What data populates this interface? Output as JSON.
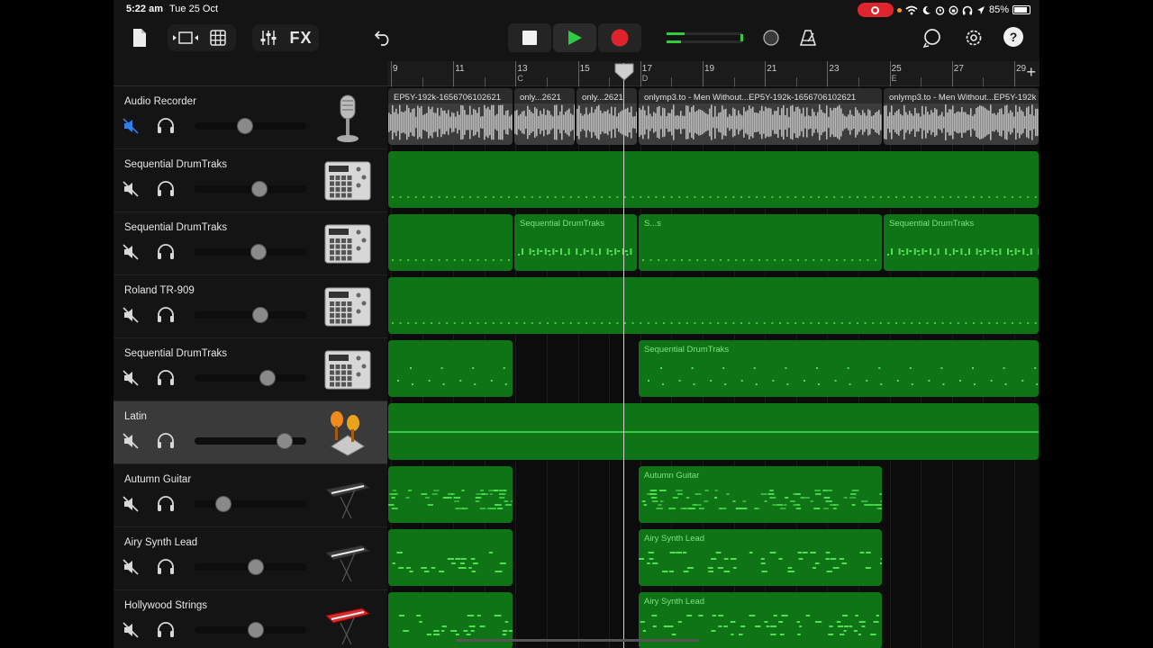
{
  "status": {
    "time": "5:22 am",
    "date": "Tue 25 Oct",
    "battery": "85%"
  },
  "toolbar": {
    "fx_label": "FX",
    "help_label": "?"
  },
  "ruler": {
    "bars": [
      "9",
      "11",
      "13",
      "15",
      "17",
      "19",
      "21",
      "23",
      "25",
      "27",
      "29"
    ],
    "markers": [
      "C",
      "D",
      "E"
    ],
    "add_label": "+"
  },
  "tracks": [
    {
      "name": "Audio Recorder",
      "muted": true,
      "volume": 0.45,
      "instrument_icon": "microphone-icon"
    },
    {
      "name": "Sequential DrumTraks",
      "muted": false,
      "volume": 0.58,
      "instrument_icon": "drum-machine-icon"
    },
    {
      "name": "Sequential DrumTraks",
      "muted": false,
      "volume": 0.57,
      "instrument_icon": "drum-machine-icon"
    },
    {
      "name": "Roland TR-909",
      "muted": false,
      "volume": 0.59,
      "instrument_icon": "drum-machine-icon"
    },
    {
      "name": "Sequential DrumTraks",
      "muted": false,
      "volume": 0.65,
      "instrument_icon": "drum-machine-icon"
    },
    {
      "name": "Latin",
      "muted": false,
      "volume": 0.81,
      "instrument_icon": "maracas-icon",
      "selected": true
    },
    {
      "name": "Autumn Guitar",
      "muted": false,
      "volume": 0.26,
      "instrument_icon": "keyboard-icon"
    },
    {
      "name": "Airy Synth Lead",
      "muted": false,
      "volume": 0.55,
      "instrument_icon": "keyboard-icon"
    },
    {
      "name": "Hollywood Strings",
      "muted": false,
      "volume": 0.55,
      "instrument_icon": "red-keyboard-icon"
    }
  ],
  "regions": {
    "audio": [
      "EP5Y-192k-1656706102621",
      "only...2621",
      "only...2621",
      "onlymp3.to - Men Without...EP5Y-192k-1656706102621",
      "onlymp3.to - Men Without...EP5Y-192k"
    ],
    "drum2": [
      "Sequential DrumTraks",
      "S...s",
      "Sequential DrumTraks"
    ],
    "drum4": [
      "Sequential DrumTraks"
    ],
    "guitar": [
      "Autumn Guitar"
    ],
    "synth": [
      "Airy Synth Lead"
    ],
    "strings": [
      "Airy Synth Lead"
    ]
  },
  "colors": {
    "region_green": "#0f7416",
    "note_green": "#4fe053",
    "record_red": "#e0242e",
    "play_green": "#2ecc40"
  }
}
